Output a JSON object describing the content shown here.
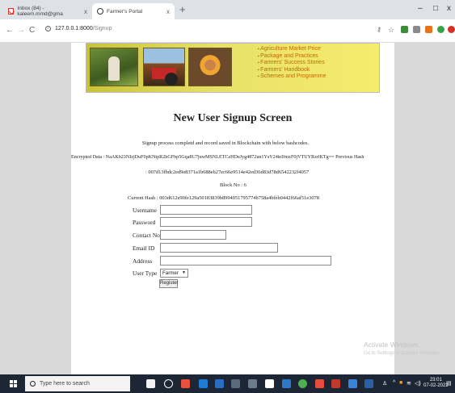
{
  "browser": {
    "tabs": [
      {
        "title": "Inbox (84) - kaleem.mmd@gma",
        "close": "x"
      },
      {
        "title": "Farmer's Portal",
        "close": "x"
      }
    ],
    "new_tab": "+",
    "window_controls": [
      "–",
      "□",
      "x"
    ],
    "nav": {
      "back": "←",
      "forward": "→",
      "reload": "C"
    },
    "url_host": "127.0.0.1:8000",
    "url_path": "/Signup"
  },
  "banner": {
    "menu": [
      "Agriculture Market Price",
      "Package and Practices",
      "Farmers' Success Stories",
      "Farmers' Handbook",
      "Schemes and Programme"
    ]
  },
  "page": {
    "title": "New User Signup Screen",
    "status_message": "Signup process completd and record saved in Blockchain with below hashcodes.",
    "encrypted_line": "Encrypted Data : NaAKb23NIzjDuF0pKNtpR2hGFbp5Gqa8U7juwMSNLETCzHDeJyg4872un1YsV24teIfmxF0jVTUYRzrlKTg== Previous Hash",
    "previous_hash": ": 007d13fbdc2ed9e8371a1b688eb27ec66e9514e42ed36d83d78d6542232f4057",
    "block_no": "Block No : 6",
    "current_hash": "Current Hash : 003d612e90fe129a50183839b8994051795774b758a4bfeb0442f66af51e3078",
    "form": {
      "username_label": "Username",
      "password_label": "Password",
      "contact_label": "Contact No",
      "email_label": "Email ID",
      "address_label": "Address",
      "usertype_label": "User Type",
      "usertype_value": "Farmer",
      "register_label": "Register"
    }
  },
  "watermark": {
    "line1": "Activate Windows",
    "line2": "Go to Settings to activate Windows."
  },
  "taskbar": {
    "search_placeholder": "Type here to search",
    "time": "23:01",
    "date": "07-02-2022"
  }
}
